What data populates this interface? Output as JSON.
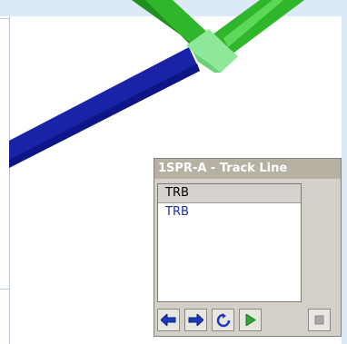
{
  "track_panel": {
    "title": "1SPR-A - Track Line",
    "items": [
      {
        "label": "TRB",
        "selected": true
      },
      {
        "label": "TRB",
        "selected": false
      }
    ]
  },
  "toolbar": {
    "buttons": [
      {
        "icon": "arrow-left-icon"
      },
      {
        "icon": "arrow-right-icon"
      },
      {
        "icon": "refresh-icon"
      },
      {
        "icon": "play-icon"
      },
      {
        "icon": "stop-icon"
      }
    ]
  },
  "colors": {
    "pipe_blue": "#1a23a8",
    "pipe_green": "#2fb62a",
    "joint_green": "#8ee89a",
    "panel_bg": "#d4d0c8",
    "title_bg": "#b7b1a4"
  }
}
